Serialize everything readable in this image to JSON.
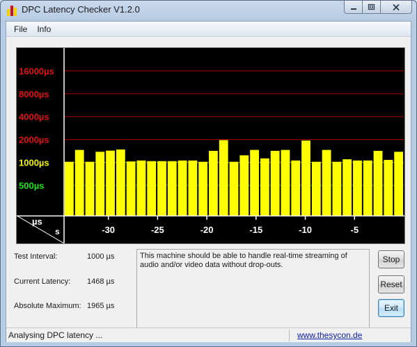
{
  "window": {
    "title": "DPC Latency Checker V1.2.0",
    "icon": "app-bars-icon",
    "controls": {
      "minimize": "minimize-icon",
      "maximize": "maximize-icon",
      "close": "close-icon"
    }
  },
  "menu": {
    "items": [
      "File",
      "Info"
    ]
  },
  "chart_data": {
    "type": "bar",
    "title": "",
    "xlabel": "s",
    "ylabel": "µs",
    "xlim": [
      -34.5,
      0
    ],
    "y_scale": "log",
    "ylim": [
      200,
      32000
    ],
    "y_ticks": [
      {
        "value": 16000,
        "label": "16000µs",
        "color": "#e01010",
        "line": "#b30000"
      },
      {
        "value": 8000,
        "label": "8000µs",
        "color": "#e01010",
        "line": "#b30000"
      },
      {
        "value": 4000,
        "label": "4000µs",
        "color": "#e01010",
        "line": "#b30000"
      },
      {
        "value": 2000,
        "label": "2000µs",
        "color": "#e01010",
        "line": "#b30000"
      },
      {
        "value": 1000,
        "label": "1000µs",
        "color": "#f5f500",
        "line": "#8a8a00"
      },
      {
        "value": 500,
        "label": "500µs",
        "color": "#19e619",
        "line": "#0c7a0c"
      }
    ],
    "x_ticks": [
      -30,
      -25,
      -20,
      -15,
      -10,
      -5
    ],
    "x_tick_labels": [
      "-30",
      "-25",
      "-20",
      "-15",
      "-10",
      "-5"
    ],
    "bar_color": "#ffff00",
    "values": [
      1020,
      1460,
      1020,
      1380,
      1430,
      1480,
      1030,
      1060,
      1040,
      1040,
      1040,
      1060,
      1060,
      1020,
      1420,
      1965,
      1020,
      1240,
      1460,
      1130,
      1420,
      1460,
      1060,
      1940,
      1020,
      1460,
      1020,
      1100,
      1060,
      1060,
      1420,
      1080,
      1380
    ]
  },
  "info": {
    "test_interval": {
      "label": "Test Interval:",
      "value": "1000 µs"
    },
    "current_latency": {
      "label": "Current Latency:",
      "value": "1468 µs"
    },
    "absolute_maximum": {
      "label": "Absolute Maximum:",
      "value": "1965 µs"
    }
  },
  "message": "This machine should be able to handle real-time streaming of audio and/or video data without drop-outs.",
  "buttons": {
    "stop": "Stop",
    "reset": "Reset",
    "exit": "Exit"
  },
  "status": {
    "text": "Analysing DPC latency ...",
    "link": "www.thesycon.de"
  }
}
